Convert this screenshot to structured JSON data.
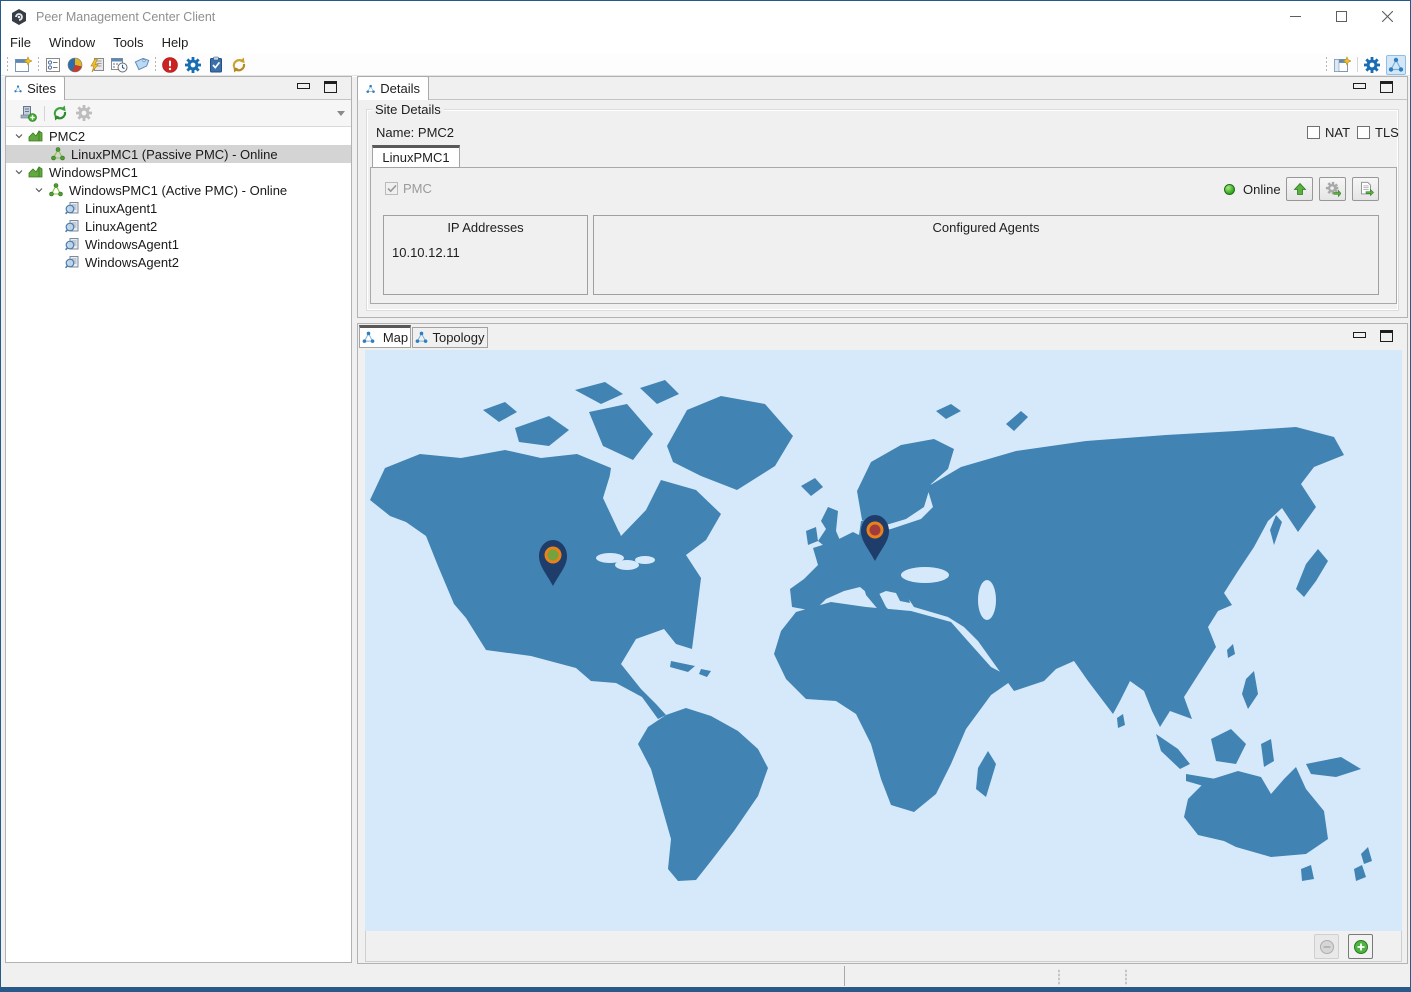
{
  "window": {
    "title": "Peer Management Center Client"
  },
  "menu": {
    "items": [
      "File",
      "Window",
      "Tools",
      "Help"
    ]
  },
  "toolbar": {
    "left_icons": [
      "new-window",
      "view-list",
      "analytics-pie",
      "power-job",
      "schedule",
      "tag",
      "alerts",
      "preferences-gear",
      "tasks-clipboard",
      "sync"
    ],
    "right_icons": [
      "open-perspective",
      "preferences-gear",
      "pmc-perspective-active"
    ]
  },
  "sites_panel": {
    "tab_label": "Sites",
    "toolbar_icons": [
      "add-site",
      "refresh",
      "settings-disabled",
      "view-menu"
    ],
    "tree": [
      {
        "label": "PMC2",
        "level": 0,
        "icon": "site",
        "expanded": true,
        "selected": false
      },
      {
        "label": "LinuxPMC1 (Passive PMC) - Online",
        "level": 1,
        "icon": "pmc-node",
        "expanded": false,
        "selected": true
      },
      {
        "label": "WindowsPMC1",
        "level": 0,
        "icon": "site",
        "expanded": true,
        "selected": false
      },
      {
        "label": "WindowsPMC1 (Active PMC) - Online",
        "level": 1,
        "icon": "pmc-node",
        "expanded": true,
        "selected": false
      },
      {
        "label": "LinuxAgent1",
        "level": 2,
        "icon": "agent",
        "expanded": false,
        "selected": false
      },
      {
        "label": "LinuxAgent2",
        "level": 2,
        "icon": "agent",
        "expanded": false,
        "selected": false
      },
      {
        "label": "WindowsAgent1",
        "level": 2,
        "icon": "agent",
        "expanded": false,
        "selected": false
      },
      {
        "label": "WindowsAgent2",
        "level": 2,
        "icon": "agent",
        "expanded": false,
        "selected": false
      }
    ]
  },
  "details_panel": {
    "tab_label": "Details",
    "group_title": "Site Details",
    "name_label": "Name: PMC2",
    "nat_label": "NAT",
    "tls_label": "TLS",
    "nat_checked": false,
    "tls_checked": false,
    "site_tab_label": "LinuxPMC1",
    "pmc_checkbox_label": "PMC",
    "pmc_checked": true,
    "status_label": "Online",
    "status_color": "#3fae2a",
    "ip_box": {
      "header": "IP Addresses",
      "rows": [
        "10.10.12.11"
      ]
    },
    "agents_box": {
      "header": "Configured Agents",
      "rows": []
    }
  },
  "map_panel": {
    "tabs": [
      "Map",
      "Topology"
    ],
    "active_tab": "Map",
    "colors": {
      "ocean": "#d5e9fb",
      "land": "#4183b2",
      "pin": "#1f3d6b",
      "pin_ring": "#e8821c",
      "pin_us_center": "#76a23c",
      "pin_eu_center": "#a23c3c"
    },
    "markers": [
      {
        "name": "north-america-site"
      },
      {
        "name": "europe-site"
      }
    ]
  }
}
